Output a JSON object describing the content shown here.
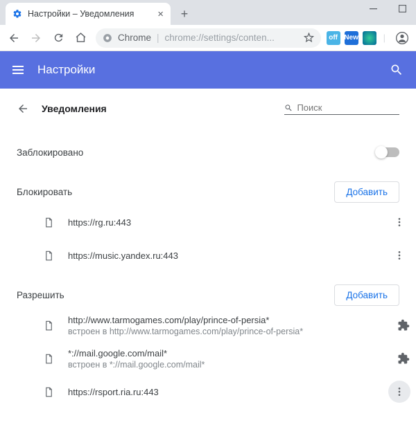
{
  "window": {
    "tab_title": "Настройки – Уведомления",
    "omnibox_prefix": "Chrome",
    "omnibox_url": "chrome://settings/conten..."
  },
  "header": {
    "title": "Настройки"
  },
  "page": {
    "title": "Уведомления",
    "search_placeholder": "Поиск",
    "blocked_label": "Заблокировано",
    "block_section": "Блокировать",
    "allow_section": "Разрешить",
    "add_button": "Добавить"
  },
  "block_list": [
    {
      "url": "https://rg.ru:443",
      "sub": ""
    },
    {
      "url": "https://music.yandex.ru:443",
      "sub": ""
    }
  ],
  "allow_list": [
    {
      "url": "http://www.tarmogames.com/play/prince-of-persia*",
      "sub": "встроен в http://www.tarmogames.com/play/prince-of-persia*",
      "ext": true
    },
    {
      "url": "*://mail.google.com/mail*",
      "sub": "встроен в *://mail.google.com/mail*",
      "ext": true
    },
    {
      "url": "https://rsport.ria.ru:443",
      "sub": "",
      "ext": false,
      "active": true
    }
  ]
}
